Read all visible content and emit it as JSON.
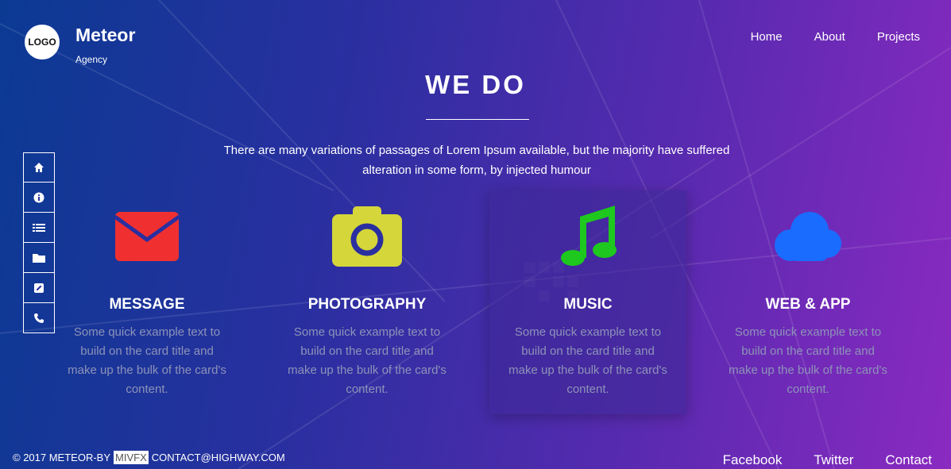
{
  "brand": {
    "logo_text": "LOGO",
    "title": "Meteor",
    "subtitle": "Agency"
  },
  "nav": {
    "items": [
      {
        "label": "Home"
      },
      {
        "label": "About"
      },
      {
        "label": "Projects"
      }
    ]
  },
  "hero": {
    "heading": "WE DO",
    "intro": "There are many variations of passages of Lorem Ipsum available, but the majority have suffered alteration in some form, by injected humour"
  },
  "side_nav": {
    "icons": [
      "home-icon",
      "info-icon",
      "list-icon",
      "folder-icon",
      "edit-icon",
      "phone-icon"
    ]
  },
  "cards": [
    {
      "title": "MESSAGE",
      "text": "Some quick example text to build on the card title and make up the bulk of the card's content.",
      "icon": "envelope-icon",
      "color": "#f03030"
    },
    {
      "title": "PHOTOGRAPHY",
      "text": "Some quick example text to build on the card title and make up the bulk of the card's content.",
      "icon": "camera-icon",
      "color": "#d4d63a"
    },
    {
      "title": "MUSIC",
      "text": "Some quick example text to build on the card title and make up the bulk of the card's content.",
      "icon": "music-note-icon",
      "color": "#1ec81e"
    },
    {
      "title": "WEB & APP",
      "text": "Some quick example text to build on the card title and make up the bulk of the card's content.",
      "icon": "cloud-icon",
      "color": "#1a6cff"
    }
  ],
  "footer": {
    "copyright_prefix": "© 2017 METEOR-BY",
    "badge": "MIVFX",
    "contact": "CONTACT@HIGHWAY.COM",
    "links": [
      {
        "label": "Facebook"
      },
      {
        "label": "Twitter"
      },
      {
        "label": "Contact"
      }
    ]
  }
}
